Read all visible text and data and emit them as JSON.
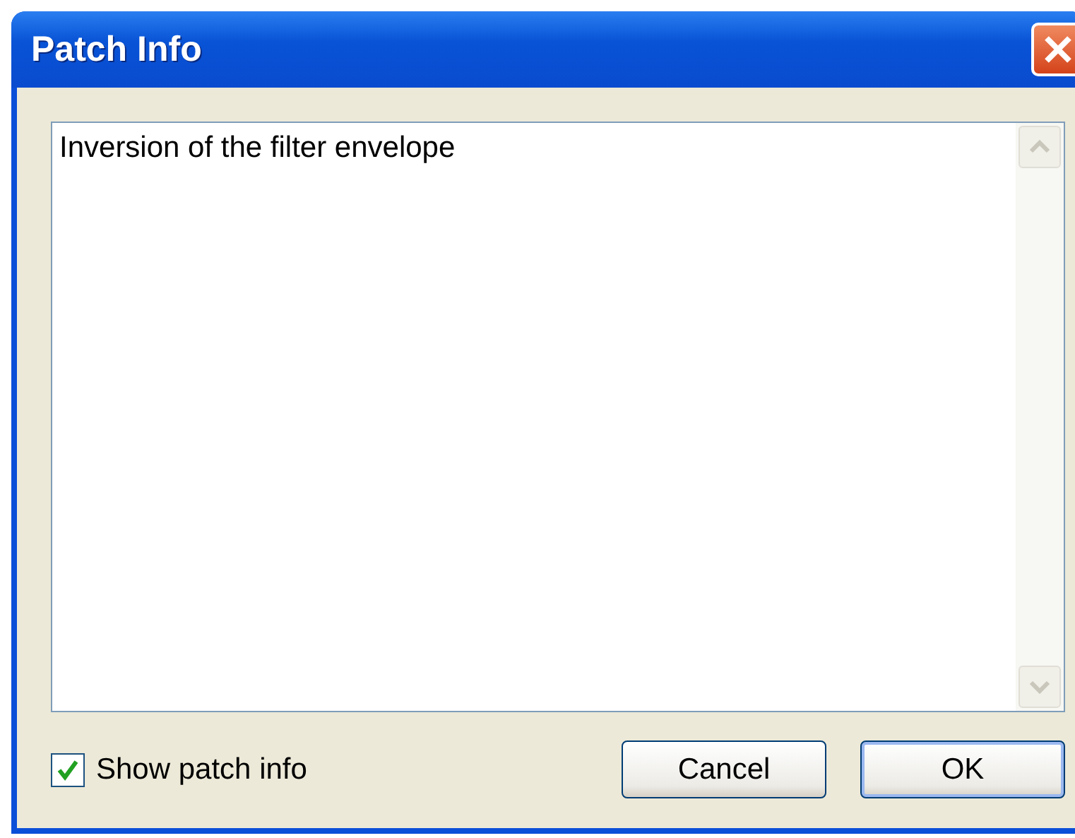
{
  "window": {
    "title": "Patch Info"
  },
  "info_text": {
    "value": "Inversion of the filter envelope",
    "scrollbar_disabled": true
  },
  "show_patch_info": {
    "label": "Show patch info",
    "checked": true
  },
  "buttons": [
    {
      "label": "Cancel",
      "default": false
    },
    {
      "label": "OK",
      "default": true
    }
  ]
}
